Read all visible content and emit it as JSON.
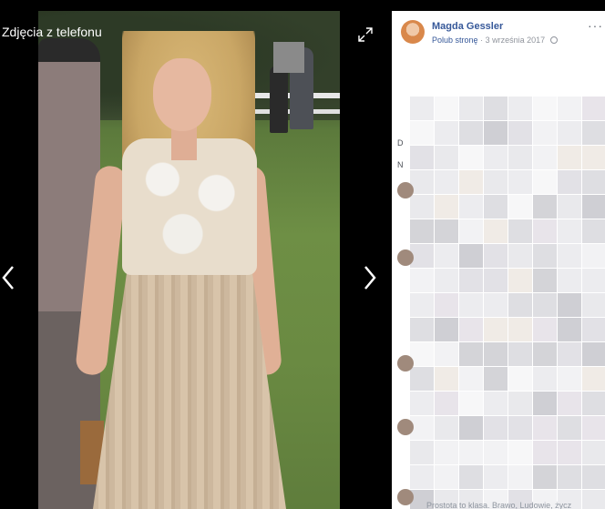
{
  "viewer": {
    "title": "Zdjęcia z telefonu",
    "icons": {
      "expand": "expand-icon",
      "prev": "chevron-left-icon",
      "next": "chevron-right-icon"
    }
  },
  "post": {
    "author": "Magda Gessler",
    "like_page": "Polub stronę",
    "separator": "·",
    "date": "3 września 2017",
    "more": "···"
  },
  "comments": {
    "letters": [
      "D",
      "N"
    ],
    "bottom_text": "Prostota to klasa. Brawo, Ludowie, życz"
  },
  "colors": {
    "link": "#365899",
    "meta": "#90949c"
  }
}
